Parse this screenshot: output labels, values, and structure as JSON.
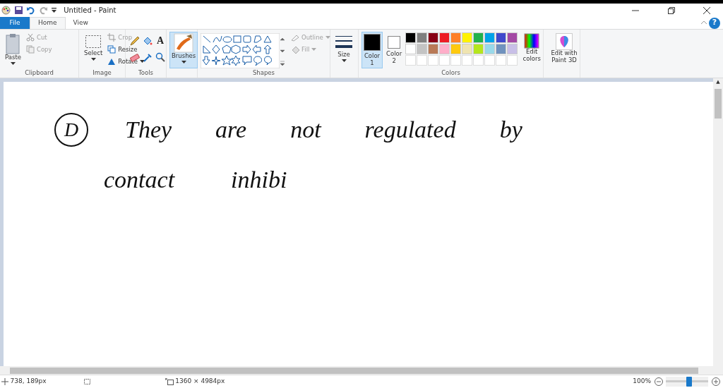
{
  "window": {
    "title": "Untitled - Paint"
  },
  "tabs": [
    {
      "label": "File",
      "kind": "file",
      "selected": false
    },
    {
      "label": "Home",
      "kind": "tab",
      "selected": true
    },
    {
      "label": "View",
      "kind": "tab",
      "selected": false
    }
  ],
  "ribbon": {
    "clipboard": {
      "label": "Clipboard",
      "paste": "Paste",
      "cut": {
        "label": "Cut",
        "disabled": true
      },
      "copy": {
        "label": "Copy",
        "disabled": true
      }
    },
    "image": {
      "label": "Image",
      "select": "Select",
      "crop": {
        "label": "Crop",
        "disabled": true
      },
      "resize": {
        "label": "Resize",
        "disabled": false
      },
      "rotate": {
        "label": "Rotate",
        "disabled": false
      }
    },
    "tools": {
      "label": "Tools",
      "text_tool": "A"
    },
    "brushes": {
      "label": "Brushes",
      "selected": true
    },
    "shapes": {
      "label": "Shapes",
      "outline": {
        "label": "Outline",
        "disabled": true
      },
      "fill": {
        "label": "Fill",
        "disabled": true
      }
    },
    "size": {
      "label": "Size"
    },
    "color1": {
      "label": "Color",
      "sub": "1",
      "color": "#000000",
      "selected": true
    },
    "color2": {
      "label": "Color",
      "sub": "2",
      "color": "#ffffff",
      "selected": false
    },
    "colors": {
      "label": "Colors",
      "palette": [
        {
          "color": "#000000"
        },
        {
          "color": "#7f7f7f"
        },
        {
          "color": "#880015"
        },
        {
          "color": "#ed1c24"
        },
        {
          "color": "#ff7f27"
        },
        {
          "color": "#fff200"
        },
        {
          "color": "#22b14c"
        },
        {
          "color": "#00a2e8"
        },
        {
          "color": "#3f48cc"
        },
        {
          "color": "#a349a4"
        },
        {
          "color": "#ffffff"
        },
        {
          "color": "#c3c3c3"
        },
        {
          "color": "#b97a57"
        },
        {
          "color": "#ffaec9"
        },
        {
          "color": "#ffc90e"
        },
        {
          "color": "#efe4b0"
        },
        {
          "color": "#b5e61d"
        },
        {
          "color": "#99d9ea"
        },
        {
          "color": "#7092be"
        },
        {
          "color": "#c8bfe7"
        }
      ],
      "edit": "Edit colors"
    },
    "paint3d": "Edit with Paint 3D"
  },
  "help": "?",
  "scroll_up": "▲",
  "canvas": {
    "mark": "D",
    "lines": [
      [
        "They",
        "are",
        "not",
        "regulated",
        "by"
      ],
      [
        "contact",
        "inhibi"
      ]
    ]
  },
  "status_bar": {
    "position": "738, 189px",
    "image_size": "1360 × 4984px",
    "zoom": "100%",
    "zoom_level": {
      "level": 0.55
    }
  }
}
